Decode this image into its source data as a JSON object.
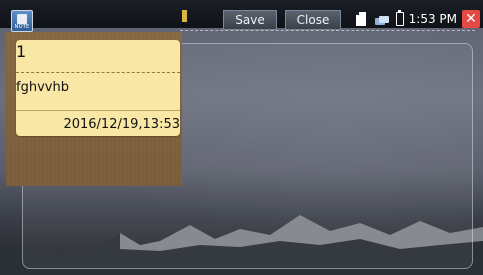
{
  "toolbar": {
    "app_icon_label": "NOTE",
    "save_label": "Save",
    "close_label": "Close"
  },
  "status": {
    "time": "1:53 PM",
    "close_symbol": "✕"
  },
  "note": {
    "title": "1",
    "body": "fghvvhb",
    "datetime": "2016/12/19,13:53"
  },
  "colors": {
    "note_yellow": "#f9e7a5",
    "sidebar_brown": "#7d5f3e",
    "close_red": "#e64844"
  }
}
